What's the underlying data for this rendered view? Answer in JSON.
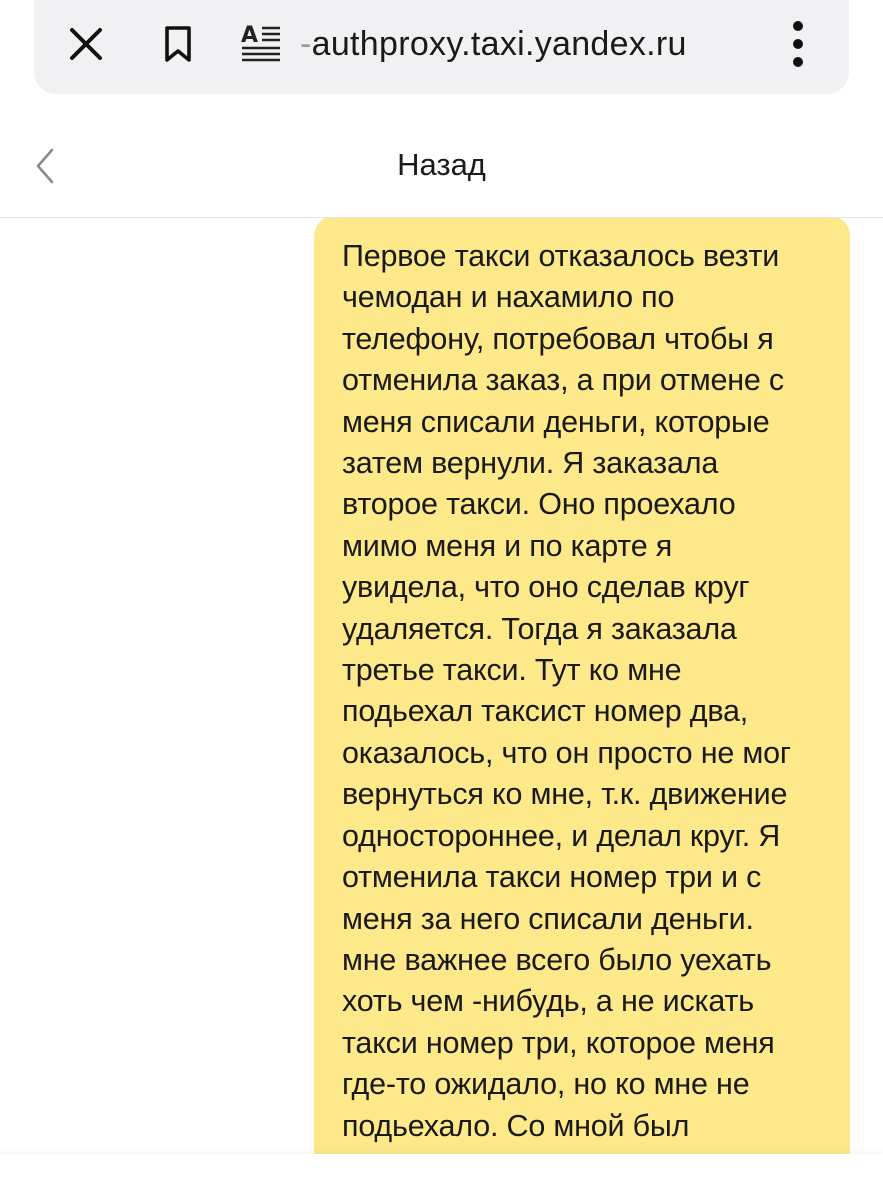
{
  "browser": {
    "url_prefix": "-",
    "url": "authproxy.taxi.yandex.ru",
    "icons": {
      "close": "close-icon",
      "bookmark": "bookmark-icon",
      "reader": "reader-mode-icon",
      "menu": "more-vertical-icon"
    }
  },
  "header": {
    "back_label": "Назад"
  },
  "chat": {
    "message": {
      "color": "#fde88a",
      "lines": [
        "Первое такси отказалось везти",
        "чемодан и нахамило по",
        "телефону, потребовал чтобы я",
        "отменила заказ, а при отмене с",
        "меня списали деньги, которые",
        "затем вернули. Я заказала",
        "второе такси. Оно проехало",
        "мимо меня и по карте я",
        "увидела, что оно сделав круг",
        "удаляется. Тогда я заказала",
        "третье такси. Тут ко мне",
        "подьехал таксист номер два,",
        "оказалось, что он просто не мог",
        "вернуться ко мне, т.к. движение",
        "одностороннее, и делал круг. Я",
        "отменила такси номер три и с",
        "меня за него списали деньги.",
        "мне важнее всего было уехать",
        "хоть чем -нибудь, а не искать",
        "такси номер три, которое меня",
        "где-то ожидало, но ко мне не",
        "подьехало. Со мной был"
      ]
    }
  }
}
